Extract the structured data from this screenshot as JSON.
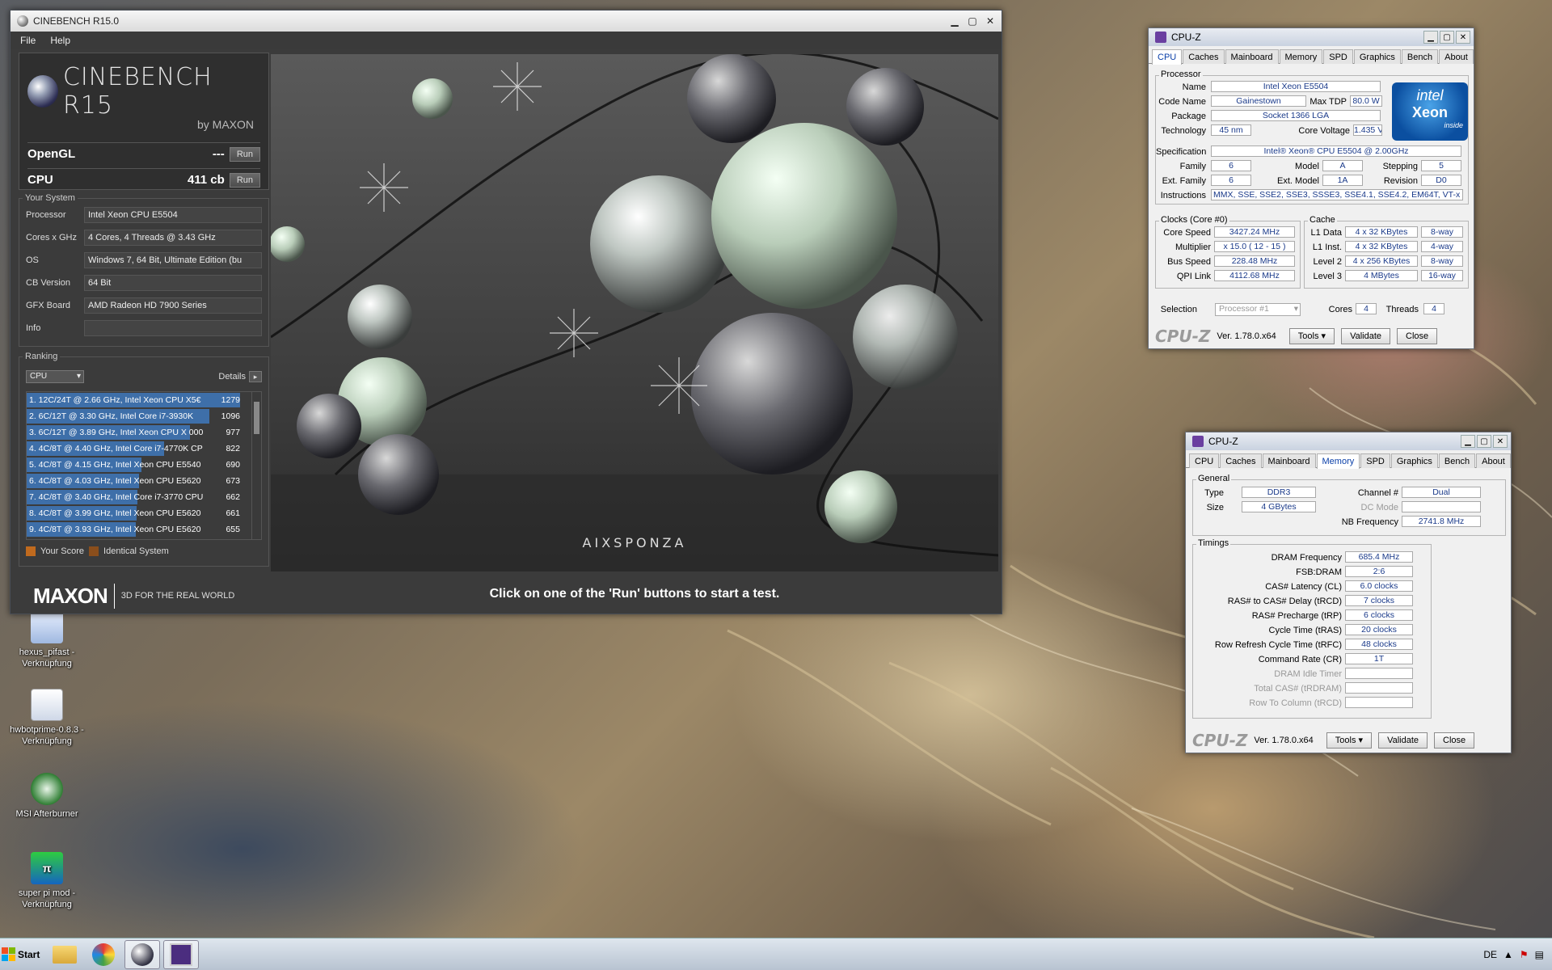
{
  "desktop": {
    "icons": [
      {
        "label": "hexus_pifast -\nVerknüpfung",
        "icon": "shortcut-icon"
      },
      {
        "label": "hwbotprime-0.8.3 -\nVerknüpfung",
        "icon": "java-icon"
      },
      {
        "label": "MSI Afterburner",
        "icon": "afterburner-icon"
      },
      {
        "label": "super pi mod -\nVerknüpfung",
        "icon": "superpi-icon"
      }
    ]
  },
  "cinebench": {
    "title": "CINEBENCH R15.0",
    "menu": [
      "File",
      "Help"
    ],
    "logo": {
      "name": "CINEBENCH R15",
      "by": "by MAXON"
    },
    "opengl": {
      "label": "OpenGL",
      "value": "---",
      "run": "Run"
    },
    "cpu": {
      "label": "CPU",
      "value": "411 cb",
      "run": "Run"
    },
    "your_system": {
      "title": "Your System",
      "rows": [
        {
          "k": "Processor",
          "v": "Intel Xeon CPU E5504"
        },
        {
          "k": "Cores x GHz",
          "v": "4 Cores, 4 Threads @ 3.43 GHz"
        },
        {
          "k": "OS",
          "v": "Windows 7, 64 Bit, Ultimate Edition (bu"
        },
        {
          "k": "CB Version",
          "v": "64 Bit"
        },
        {
          "k": "GFX Board",
          "v": "AMD Radeon HD 7900 Series"
        },
        {
          "k": "Info",
          "v": ""
        }
      ]
    },
    "ranking": {
      "title": "Ranking",
      "select": "CPU",
      "details": "Details",
      "items": [
        {
          "name": "1. 12C/24T @ 2.66 GHz, Intel Xeon CPU X5€",
          "score": "1279",
          "frac": 1.0
        },
        {
          "name": "2. 6C/12T @ 3.30 GHz,  Intel Core i7-3930K",
          "score": "1096",
          "frac": 0.857
        },
        {
          "name": "3. 6C/12T @ 3.89 GHz, Intel Xeon CPU X 000",
          "score": "977",
          "frac": 0.764
        },
        {
          "name": "4. 4C/8T @ 4.40 GHz, Intel Core i7-4770K CP",
          "score": "822",
          "frac": 0.643
        },
        {
          "name": "5. 4C/8T @ 4.15 GHz, Intel Xeon CPU E5540",
          "score": "690",
          "frac": 0.539
        },
        {
          "name": "6. 4C/8T @ 4.03 GHz, Intel Xeon CPU E5620",
          "score": "673",
          "frac": 0.526
        },
        {
          "name": "7. 4C/8T @ 3.40 GHz,  Intel Core i7-3770 CPU",
          "score": "662",
          "frac": 0.518
        },
        {
          "name": "8. 4C/8T @ 3.99 GHz, Intel Xeon CPU E5620",
          "score": "661",
          "frac": 0.517
        },
        {
          "name": "9. 4C/8T @ 3.93 GHz, Intel Xeon CPU E5620",
          "score": "655",
          "frac": 0.512
        }
      ],
      "legend_your": "Your Score",
      "legend_identical": "Identical System"
    },
    "footer": {
      "brand": "MAXON",
      "tagline": "3D FOR THE REAL WORLD"
    },
    "render_brand": "AIXSPONZA",
    "status": "Click on one of the 'Run' buttons to start a test."
  },
  "cpuz1": {
    "title": "CPU-Z",
    "tabs": [
      "CPU",
      "Caches",
      "Mainboard",
      "Memory",
      "SPD",
      "Graphics",
      "Bench",
      "About"
    ],
    "active_tab": "CPU",
    "processor": {
      "title": "Processor",
      "name_l": "Name",
      "name": "Intel Xeon E5504",
      "code_l": "Code Name",
      "code": "Gainestown",
      "tdp_l": "Max TDP",
      "tdp": "80.0 W",
      "pkg_l": "Package",
      "pkg": "Socket 1366 LGA",
      "tech_l": "Technology",
      "tech": "45 nm",
      "volt_l": "Core Voltage",
      "volt": "1.435 V",
      "spec_l": "Specification",
      "spec": "Intel® Xeon® CPU          E5504  @ 2.00GHz",
      "fam_l": "Family",
      "fam": "6",
      "model_l": "Model",
      "model": "A",
      "step_l": "Stepping",
      "step": "5",
      "efam_l": "Ext. Family",
      "efam": "6",
      "emodel_l": "Ext. Model",
      "emodel": "1A",
      "rev_l": "Revision",
      "rev": "D0",
      "instr_l": "Instructions",
      "instr": "MMX, SSE, SSE2, SSE3, SSSE3, SSE4.1, SSE4.2, EM64T, VT-x",
      "badge": {
        "brand": "intel",
        "line": "Xeon",
        "sub": "inside"
      }
    },
    "clocks": {
      "title": "Clocks (Core #0)",
      "speed_l": "Core Speed",
      "speed": "3427.24 MHz",
      "mult_l": "Multiplier",
      "mult": "x 15.0 ( 12 - 15 )",
      "bus_l": "Bus Speed",
      "bus": "228.48 MHz",
      "qpi_l": "QPI Link",
      "qpi": "4112.68 MHz"
    },
    "cache": {
      "title": "Cache",
      "rows": [
        {
          "k": "L1 Data",
          "v": "4 x 32 KBytes",
          "w": "8-way"
        },
        {
          "k": "L1 Inst.",
          "v": "4 x 32 KBytes",
          "w": "4-way"
        },
        {
          "k": "Level 2",
          "v": "4 x 256 KBytes",
          "w": "8-way"
        },
        {
          "k": "Level 3",
          "v": "4 MBytes",
          "w": "16-way"
        }
      ]
    },
    "selection_l": "Selection",
    "selection": "Processor #1",
    "cores_l": "Cores",
    "cores": "4",
    "threads_l": "Threads",
    "threads": "4",
    "logo": "CPU-Z",
    "version": "Ver. 1.78.0.x64",
    "tools": "Tools",
    "validate": "Validate",
    "close": "Close"
  },
  "cpuz2": {
    "title": "CPU-Z",
    "tabs": [
      "CPU",
      "Caches",
      "Mainboard",
      "Memory",
      "SPD",
      "Graphics",
      "Bench",
      "About"
    ],
    "active_tab": "Memory",
    "general": {
      "title": "General",
      "type_l": "Type",
      "type": "DDR3",
      "size_l": "Size",
      "size": "4 GBytes",
      "chan_l": "Channel #",
      "chan": "Dual",
      "dc_l": "DC Mode",
      "dc": "",
      "nb_l": "NB Frequency",
      "nb": "2741.8 MHz"
    },
    "timings": {
      "title": "Timings",
      "rows": [
        {
          "k": "DRAM Frequency",
          "v": "685.4 MHz",
          "dis": false
        },
        {
          "k": "FSB:DRAM",
          "v": "2:6",
          "dis": false
        },
        {
          "k": "CAS# Latency (CL)",
          "v": "6.0 clocks",
          "dis": false
        },
        {
          "k": "RAS# to CAS# Delay (tRCD)",
          "v": "7 clocks",
          "dis": false
        },
        {
          "k": "RAS# Precharge (tRP)",
          "v": "6 clocks",
          "dis": false
        },
        {
          "k": "Cycle Time (tRAS)",
          "v": "20 clocks",
          "dis": false
        },
        {
          "k": "Row Refresh Cycle Time (tRFC)",
          "v": "48 clocks",
          "dis": false
        },
        {
          "k": "Command Rate (CR)",
          "v": "1T",
          "dis": false
        },
        {
          "k": "DRAM Idle Timer",
          "v": "",
          "dis": true
        },
        {
          "k": "Total CAS# (tRDRAM)",
          "v": "",
          "dis": true
        },
        {
          "k": "Row To Column (tRCD)",
          "v": "",
          "dis": true
        }
      ]
    },
    "logo": "CPU-Z",
    "version": "Ver. 1.78.0.x64",
    "tools": "Tools",
    "validate": "Validate",
    "close": "Close"
  },
  "taskbar": {
    "start": "Start",
    "lang": "DE"
  }
}
